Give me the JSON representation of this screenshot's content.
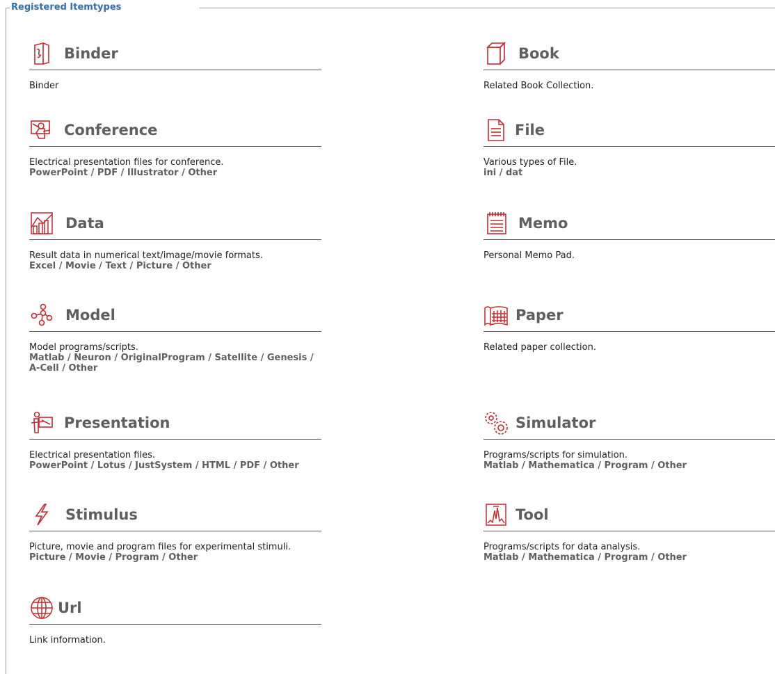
{
  "legend": "Registered Itemtypes",
  "items": [
    {
      "title": "Binder",
      "description": "Binder",
      "formats": "",
      "formats2": "",
      "icon": "binder-icon"
    },
    {
      "title": "Book",
      "description": "Related Book Collection.",
      "formats": "",
      "formats2": "",
      "icon": "book-icon"
    },
    {
      "title": "Conference",
      "description": "Electrical presentation files for conference.",
      "formats": "PowerPoint / PDF / Illustrator / Other",
      "formats2": "",
      "icon": "conference-icon"
    },
    {
      "title": "File",
      "description": "Various types of File.",
      "formats": "ini / dat",
      "formats2": "",
      "icon": "file-icon"
    },
    {
      "title": "Data",
      "description": "Result data in numerical text/image/movie formats.",
      "formats": "Excel / Movie / Text / Picture / Other",
      "formats2": "",
      "icon": "data-icon"
    },
    {
      "title": "Memo",
      "description": "Personal Memo Pad.",
      "formats": "",
      "formats2": "",
      "icon": "memo-icon"
    },
    {
      "title": "Model",
      "description": "Model programs/scripts.",
      "formats": "Matlab / Neuron / OriginalProgram / Satellite / Genesis /",
      "formats2": "A-Cell / Other",
      "icon": "model-icon"
    },
    {
      "title": "Paper",
      "description": "Related paper collection.",
      "formats": "",
      "formats2": "",
      "icon": "paper-icon"
    },
    {
      "title": "Presentation",
      "description": "Electrical presentation files.",
      "formats": "PowerPoint / Lotus / JustSystem / HTML / PDF / Other",
      "formats2": "",
      "icon": "presentation-icon"
    },
    {
      "title": "Simulator",
      "description": "Programs/scripts for simulation.",
      "formats": "Matlab / Mathematica / Program / Other",
      "formats2": "",
      "icon": "simulator-icon"
    },
    {
      "title": "Stimulus",
      "description": "Picture, movie and program files for experimental stimuli.",
      "formats": "Picture / Movie / Program / Other",
      "formats2": "",
      "icon": "stimulus-icon"
    },
    {
      "title": "Tool",
      "description": "Programs/scripts for data analysis.",
      "formats": "Matlab / Mathematica / Program / Other",
      "formats2": "",
      "icon": "tool-icon"
    },
    {
      "title": "Url",
      "description": "Link information.",
      "formats": "",
      "formats2": "",
      "icon": "url-icon"
    }
  ],
  "colors": {
    "icon": "#c8282d",
    "title": "#5f5f5f",
    "legend": "#2f6fb3"
  }
}
